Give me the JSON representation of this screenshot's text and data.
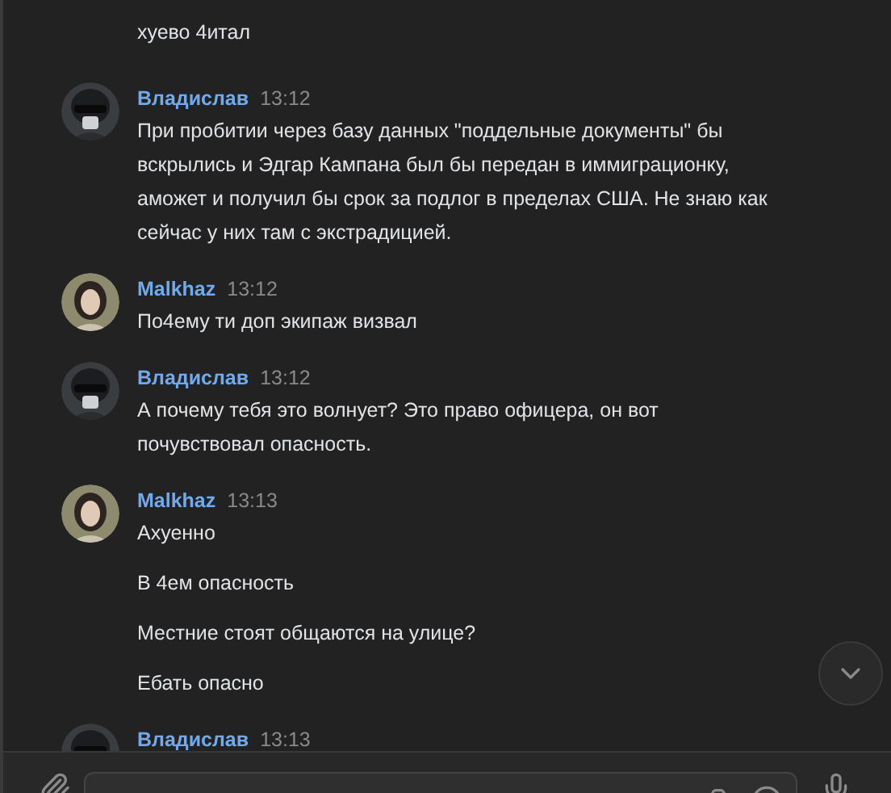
{
  "messages": [
    {
      "texts": [
        "хуево 4итал"
      ]
    },
    {
      "author": "Владислав",
      "time": "13:12",
      "kind": "helmet",
      "texts": [
        "При пробитии через базу данных \"поддельные документы\" бы вскрылись и Эдгар Кампана был бы передан в иммиграционку, аможет и получил бы срок за подлог в пределах США. Не знаю как сейчас у них там с экстрадицией."
      ]
    },
    {
      "author": "Malkhaz",
      "time": "13:12",
      "kind": "girl",
      "texts": [
        "По4ему ти доп экипаж визвал"
      ]
    },
    {
      "author": "Владислав",
      "time": "13:12",
      "kind": "helmet",
      "texts": [
        "А почему тебя это волнует? Это право офицера, он вот почувствовал опасность."
      ]
    },
    {
      "author": "Malkhaz",
      "time": "13:13",
      "kind": "girl",
      "texts": [
        "Ахуенно",
        "В 4ем опасность",
        "Местние стоят общаются на улице?",
        "Ебать опасно"
      ]
    },
    {
      "author": "Владислав",
      "time": "13:13",
      "kind": "helmet"
    }
  ]
}
